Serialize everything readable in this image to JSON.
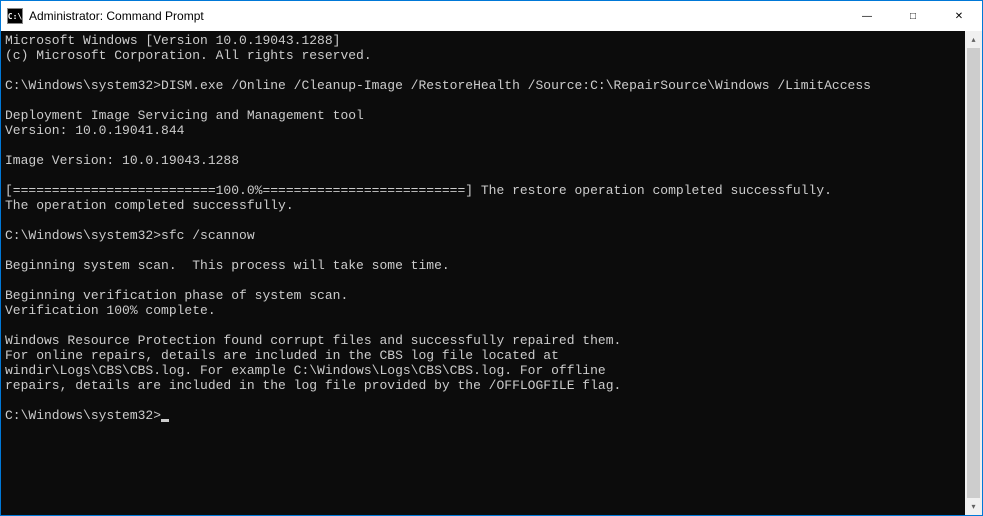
{
  "titlebar": {
    "icon_label": "C:\\",
    "title": "Administrator: Command Prompt"
  },
  "window_controls": {
    "minimize": "—",
    "maximize": "□",
    "close": "✕"
  },
  "terminal": {
    "lines": [
      "Microsoft Windows [Version 10.0.19043.1288]",
      "(c) Microsoft Corporation. All rights reserved.",
      "",
      "C:\\Windows\\system32>DISM.exe /Online /Cleanup-Image /RestoreHealth /Source:C:\\RepairSource\\Windows /LimitAccess",
      "",
      "Deployment Image Servicing and Management tool",
      "Version: 10.0.19041.844",
      "",
      "Image Version: 10.0.19043.1288",
      "",
      "[==========================100.0%==========================] The restore operation completed successfully.",
      "The operation completed successfully.",
      "",
      "C:\\Windows\\system32>sfc /scannow",
      "",
      "Beginning system scan.  This process will take some time.",
      "",
      "Beginning verification phase of system scan.",
      "Verification 100% complete.",
      "",
      "Windows Resource Protection found corrupt files and successfully repaired them.",
      "For online repairs, details are included in the CBS log file located at",
      "windir\\Logs\\CBS\\CBS.log. For example C:\\Windows\\Logs\\CBS\\CBS.log. For offline",
      "repairs, details are included in the log file provided by the /OFFLOGFILE flag.",
      ""
    ],
    "prompt": "C:\\Windows\\system32>"
  },
  "scrollbar": {
    "up_arrow": "▴",
    "down_arrow": "▾"
  }
}
